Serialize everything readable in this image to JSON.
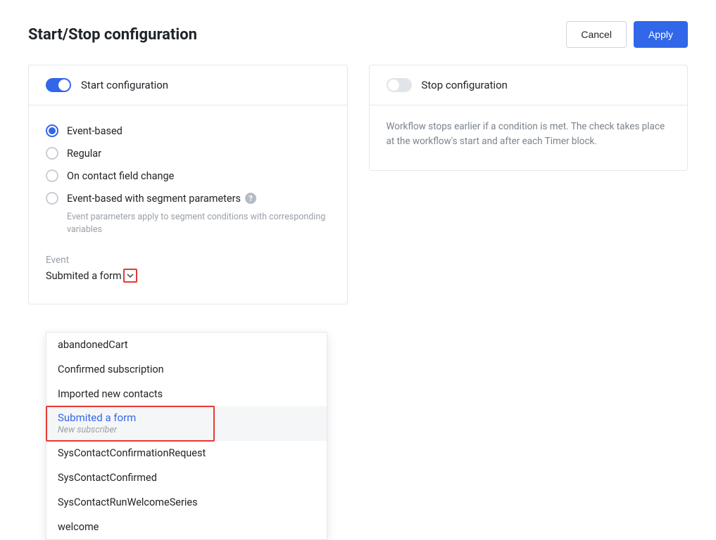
{
  "header": {
    "title": "Start/Stop configuration",
    "cancel_label": "Cancel",
    "apply_label": "Apply"
  },
  "start_panel": {
    "title": "Start configuration",
    "radios": {
      "event_based": "Event-based",
      "regular": "Regular",
      "on_contact_field_change": "On contact field change",
      "event_based_segment": "Event-based with segment parameters",
      "segment_hint": "Event parameters apply to segment conditions with corresponding variables"
    },
    "event_label": "Event",
    "selected_event": "Submited a form",
    "dropdown": {
      "abandoned_cart": "abandonedCart",
      "confirmed_subscription": "Confirmed subscription",
      "imported_new_contacts": "Imported new contacts",
      "submitted_form": "Submited a form",
      "submitted_form_sub": "New subscriber",
      "sys_confirm_request": "SysContactConfirmationRequest",
      "sys_confirmed": "SysContactConfirmed",
      "sys_run_welcome": "SysContactRunWelcomeSeries",
      "welcome": "welcome"
    }
  },
  "stop_panel": {
    "title": "Stop configuration",
    "description": "Workflow stops earlier if a condition is met. The check takes place at the workflow's start and after each Timer block."
  }
}
